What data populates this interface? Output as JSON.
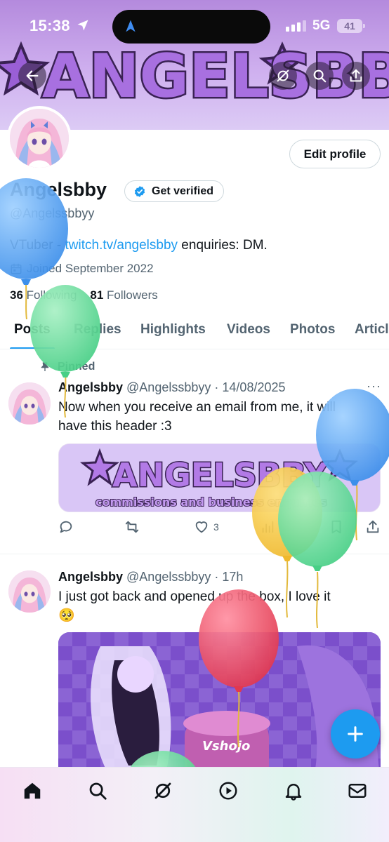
{
  "status_bar": {
    "time": "15:38",
    "network": "5G",
    "battery": "41"
  },
  "banner": {
    "brand_text": "ANGELSBBY"
  },
  "profile": {
    "name": "Angelsbby",
    "get_verified_label": "Get verified",
    "handle": "@Angelssbbyy",
    "edit_profile_label": "Edit profile",
    "bio_prefix": "VTuber - ",
    "bio_link": "twitch.tv/angelsbby",
    "bio_suffix": " enquiries: DM.",
    "joined": "Joined September 2022",
    "following_count": "36",
    "following_label": "Following",
    "followers_count": "81",
    "followers_label": "Followers"
  },
  "tabs": [
    {
      "label": "Posts",
      "active": true
    },
    {
      "label": "Replies",
      "active": false
    },
    {
      "label": "Highlights",
      "active": false
    },
    {
      "label": "Videos",
      "active": false
    },
    {
      "label": "Photos",
      "active": false
    },
    {
      "label": "Articl",
      "active": false
    }
  ],
  "posts": [
    {
      "pinned_label": "Pinned",
      "author": "Angelsbby",
      "handle": "@Angelssbbyy",
      "separator": "·",
      "date": "14/08/2025",
      "text": "Now when you receive an email from me, it will have this header :3",
      "media_title": "ANGELSBBY",
      "media_subtitle": "commissions and business enquiries",
      "likes": "3"
    },
    {
      "author": "Angelsbby",
      "handle": "@Angelssbbyy",
      "separator": "·",
      "date": "17h",
      "text": "I just got back and opened up the box, I love it",
      "emoji": "🥺",
      "media_label": "Vshojo"
    }
  ],
  "fab": {
    "icon": "plus-icon"
  },
  "bottom_nav": [
    "home-icon",
    "search-icon",
    "grok-icon",
    "play-icon",
    "bell-icon",
    "mail-icon"
  ],
  "colors": {
    "accent": "#1d9bf0",
    "banner": "#c9a7ec",
    "verified": "#1d9bf0"
  }
}
